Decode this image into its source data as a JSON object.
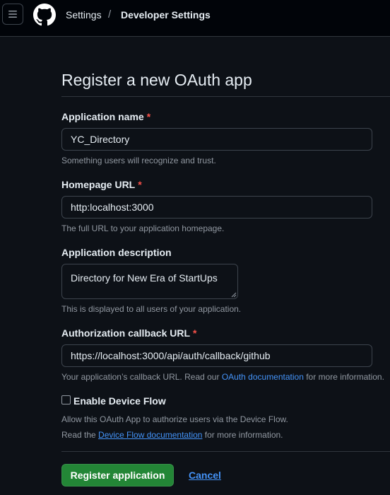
{
  "header": {
    "menu_icon": "hamburger-icon",
    "logo_icon": "github-logo-icon",
    "breadcrumb": [
      "Settings",
      "Developer Settings"
    ],
    "separator": "/"
  },
  "page": {
    "title": "Register a new OAuth app"
  },
  "form": {
    "app_name": {
      "label": "Application name",
      "required_mark": "*",
      "value": "YC_Directory",
      "hint": "Something users will recognize and trust."
    },
    "homepage_url": {
      "label": "Homepage URL",
      "required_mark": "*",
      "value": "http:localhost:3000",
      "hint": "The full URL to your application homepage."
    },
    "description": {
      "label": "Application description",
      "value": "Directory for New Era of StartUps",
      "hint": "This is displayed to all users of your application."
    },
    "callback_url": {
      "label": "Authorization callback URL",
      "required_mark": "*",
      "value": "https://localhost:3000/api/auth/callback/github",
      "hint_before": "Your application’s callback URL. Read our ",
      "hint_link": "OAuth documentation",
      "hint_after": " for more information."
    },
    "device_flow": {
      "label": "Enable Device Flow",
      "checked": false,
      "hint_line1": "Allow this OAuth App to authorize users via the Device Flow.",
      "hint_line2_before": "Read the ",
      "hint_line2_link": "Device Flow documentation",
      "hint_line2_after": " for more information."
    }
  },
  "actions": {
    "register_label": "Register application",
    "cancel_label": "Cancel"
  },
  "colors": {
    "background": "#0d1117",
    "header": "#010409",
    "primary_button": "#238636",
    "link": "#4493f8",
    "required": "#f85149",
    "muted_text": "#9198a1"
  }
}
